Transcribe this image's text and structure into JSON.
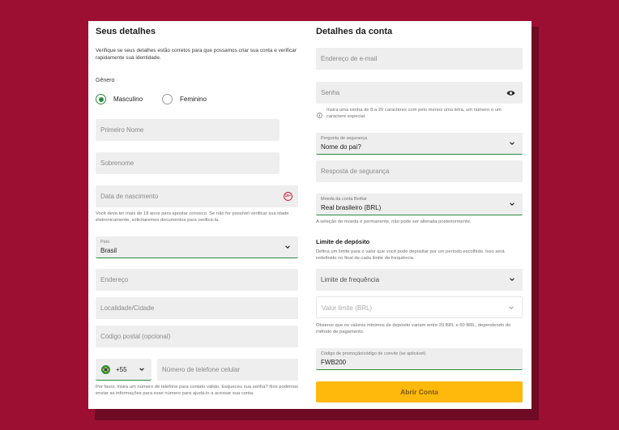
{
  "left": {
    "title": "Seus detalhes",
    "intro": "Verifique se seus detalhes estão corretos para que possamos criar sua conta e verificar rapidamente sua identidade.",
    "gender_label": "Gênero",
    "gender_options": [
      "Masculino",
      "Feminino"
    ],
    "gender_selected": "Masculino",
    "first_name_ph": "Primeiro Nome",
    "last_name_ph": "Sobrenome",
    "dob_ph": "Data de nascimento",
    "dob_badge": "18+",
    "dob_note": "Você deve ter mais de 18 anos para apostar conosco. Se não for possível verificar sua idade eletronicamente, solicitaremos documentos para verificá-la.",
    "country_caption": "País",
    "country_value": "Brasil",
    "address_ph": "Endereço",
    "city_ph": "Localidade/Cidade",
    "postcode_ph": "Código postal (opcional)",
    "phone_code": "+55",
    "phone_ph": "Número de telefone celular",
    "phone_note": "Por favor, insira um número de telefone para contato válido. Esqueceu sua senha? Nós podemos enviar as informações para esse número para ajudá-lo a acessar sua conta."
  },
  "right": {
    "title": "Detalhes da conta",
    "email_ph": "Endereço de e-mail",
    "password_ph": "Senha",
    "password_hint": "Insira uma senha de 8 a 20 caracteres com pelo menos uma letra, um número e um caractere especial.",
    "security_q_caption": "Pergunta de segurança",
    "security_q_value": "Nome do pai?",
    "security_a_ph": "Resposta de segurança",
    "currency_caption": "Moeda da conta Betfair",
    "currency_value": "Real brasileiro (BRL)",
    "currency_note": "A seleção de moeda é permanente, não pode ser alterada posteriormente.",
    "deposit_title": "Limite de depósito",
    "deposit_intro": "Defina um limite para o valor que você pode depositar por um período escolhido. Isso será redefinido no final de cada limite de frequência.",
    "frequency_ph": "Limite de frequência",
    "limit_value_ph": "Valor limite (BRL)",
    "limit_note": "Observe que os valores mínimos de depósito variam entre 20 BRL e 60 BRL, dependendo do método de pagamento.",
    "promo_caption": "Código de promoção/código de convite (se aplicável)",
    "promo_value": "FWB200",
    "submit_label": "Abrir Conta"
  },
  "colors": {
    "background": "#9c0f33",
    "accent_green": "#2c8a3f",
    "button_yellow": "#ffb80c",
    "age_badge_red": "#d11f3a"
  },
  "icons": [
    "radio-selected-icon",
    "radio-unselected-icon",
    "age-18-icon",
    "chevron-down-icon",
    "eye-icon",
    "info-icon",
    "brazil-flag-icon"
  ]
}
